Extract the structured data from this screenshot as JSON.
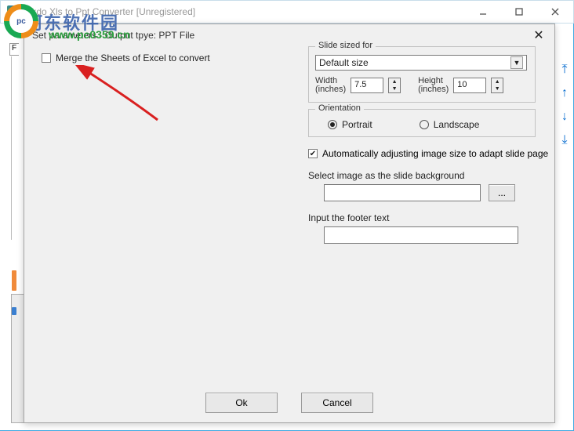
{
  "window": {
    "title": "Okdo Xls to Ppt Converter [Unregistered]"
  },
  "watermark": {
    "name": "河东软件园",
    "url": "www.pc0359.cn",
    "badge": "pc"
  },
  "side_panel": {
    "tab_label": "F"
  },
  "side_arrows": {
    "first": "⤒",
    "up": "↑",
    "down": "↓",
    "last": "⤓"
  },
  "dialog": {
    "title": "Set parameters - Output tpye: PPT File",
    "close": "✕",
    "merge_label": "Merge the Sheets of Excel to convert",
    "merge_checked": false,
    "slide_size": {
      "legend": "Slide sized for",
      "selected": "Default size",
      "width_label1": "Width",
      "width_label2": "(inches)",
      "width_value": "7.5",
      "height_label1": "Height",
      "height_label2": "(inches)",
      "height_value": "10"
    },
    "orientation": {
      "legend": "Orientation",
      "portrait": "Portrait",
      "landscape": "Landscape",
      "selected": "portrait"
    },
    "auto_adjust": {
      "checked": true,
      "mark": "✔",
      "label": "Automatically adjusting image size to adapt slide page"
    },
    "bg_section": {
      "label": "Select image as the slide background",
      "value": "",
      "browse": "..."
    },
    "footer_section": {
      "label": "Input the footer text",
      "value": ""
    },
    "buttons": {
      "ok": "Ok",
      "cancel": "Cancel"
    }
  }
}
